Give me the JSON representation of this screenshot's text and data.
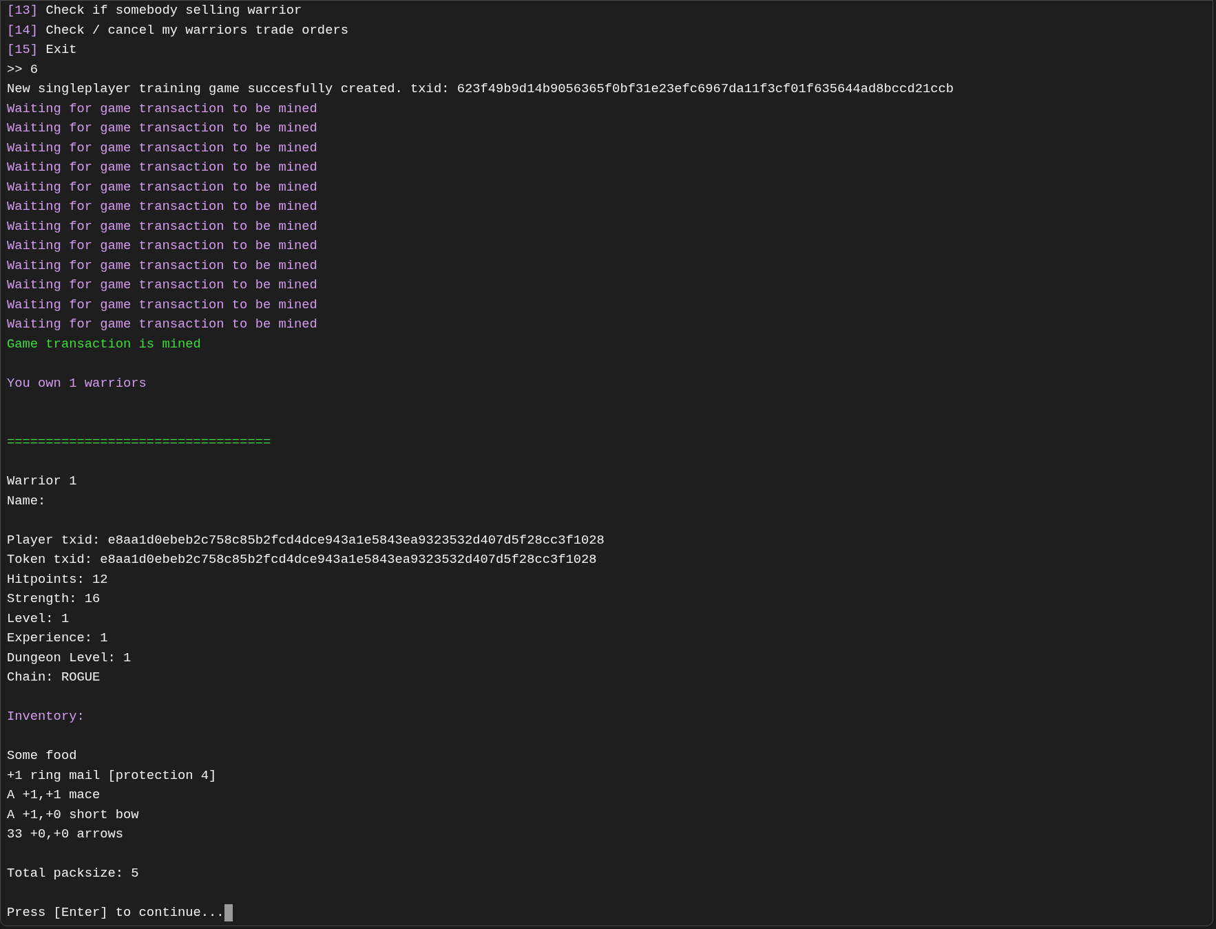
{
  "lines": [
    {
      "kind": "menu",
      "number": "[13]",
      "text": "Check if somebody selling warrior"
    },
    {
      "kind": "menu",
      "number": "[14]",
      "text": "Check / cancel my warriors trade orders"
    },
    {
      "kind": "menu",
      "number": "[15]",
      "text": "Exit"
    },
    {
      "kind": "text",
      "color": "#f2f2f2",
      "text": ">> 6"
    },
    {
      "kind": "text",
      "color": "#f2f2f2",
      "text": "New singleplayer training game succesfully created. txid: 623f49b9d14b9056365f0bf31e23efc6967da11f3cf01f635644ad8bccd21ccb"
    },
    {
      "kind": "text",
      "color": "#d49cf0",
      "text": "Waiting for game transaction to be mined"
    },
    {
      "kind": "text",
      "color": "#d49cf0",
      "text": "Waiting for game transaction to be mined"
    },
    {
      "kind": "text",
      "color": "#d49cf0",
      "text": "Waiting for game transaction to be mined"
    },
    {
      "kind": "text",
      "color": "#d49cf0",
      "text": "Waiting for game transaction to be mined"
    },
    {
      "kind": "text",
      "color": "#d49cf0",
      "text": "Waiting for game transaction to be mined"
    },
    {
      "kind": "text",
      "color": "#d49cf0",
      "text": "Waiting for game transaction to be mined"
    },
    {
      "kind": "text",
      "color": "#d49cf0",
      "text": "Waiting for game transaction to be mined"
    },
    {
      "kind": "text",
      "color": "#d49cf0",
      "text": "Waiting for game transaction to be mined"
    },
    {
      "kind": "text",
      "color": "#d49cf0",
      "text": "Waiting for game transaction to be mined"
    },
    {
      "kind": "text",
      "color": "#d49cf0",
      "text": "Waiting for game transaction to be mined"
    },
    {
      "kind": "text",
      "color": "#d49cf0",
      "text": "Waiting for game transaction to be mined"
    },
    {
      "kind": "text",
      "color": "#d49cf0",
      "text": "Waiting for game transaction to be mined"
    },
    {
      "kind": "text",
      "color": "#3fdc3f",
      "text": "Game transaction is mined"
    },
    {
      "kind": "blank"
    },
    {
      "kind": "text",
      "color": "#d49cf0",
      "text": "You own 1 warriors"
    },
    {
      "kind": "blank"
    },
    {
      "kind": "blank"
    },
    {
      "kind": "text",
      "color": "#3fdc3f",
      "text": "=================================="
    },
    {
      "kind": "blank"
    },
    {
      "kind": "text",
      "color": "#f2f2f2",
      "text": "Warrior 1"
    },
    {
      "kind": "text",
      "color": "#f2f2f2",
      "text": "Name:"
    },
    {
      "kind": "blank"
    },
    {
      "kind": "text",
      "color": "#f2f2f2",
      "text": "Player txid: e8aa1d0ebeb2c758c85b2fcd4dce943a1e5843ea9323532d407d5f28cc3f1028"
    },
    {
      "kind": "text",
      "color": "#f2f2f2",
      "text": "Token txid: e8aa1d0ebeb2c758c85b2fcd4dce943a1e5843ea9323532d407d5f28cc3f1028"
    },
    {
      "kind": "text",
      "color": "#f2f2f2",
      "text": "Hitpoints: 12"
    },
    {
      "kind": "text",
      "color": "#f2f2f2",
      "text": "Strength: 16"
    },
    {
      "kind": "text",
      "color": "#f2f2f2",
      "text": "Level: 1"
    },
    {
      "kind": "text",
      "color": "#f2f2f2",
      "text": "Experience: 1"
    },
    {
      "kind": "text",
      "color": "#f2f2f2",
      "text": "Dungeon Level: 1"
    },
    {
      "kind": "text",
      "color": "#f2f2f2",
      "text": "Chain: ROGUE"
    },
    {
      "kind": "blank"
    },
    {
      "kind": "text",
      "color": "#d49cf0",
      "text": "Inventory:"
    },
    {
      "kind": "blank"
    },
    {
      "kind": "text",
      "color": "#f2f2f2",
      "text": "Some food"
    },
    {
      "kind": "text",
      "color": "#f2f2f2",
      "text": "+1 ring mail [protection 4]"
    },
    {
      "kind": "text",
      "color": "#f2f2f2",
      "text": "A +1,+1 mace"
    },
    {
      "kind": "text",
      "color": "#f2f2f2",
      "text": "A +1,+0 short bow"
    },
    {
      "kind": "text",
      "color": "#f2f2f2",
      "text": "33 +0,+0 arrows"
    },
    {
      "kind": "blank"
    },
    {
      "kind": "text",
      "color": "#f2f2f2",
      "text": "Total packsize: 5"
    },
    {
      "kind": "blank"
    },
    {
      "kind": "text",
      "color": "#f2f2f2",
      "text": "Press [Enter] to continue...",
      "cursor": true
    }
  ]
}
